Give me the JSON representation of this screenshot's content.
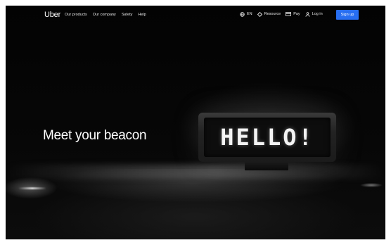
{
  "nav": {
    "logo": "Uber",
    "links": [
      "Our products",
      "Our company",
      "Safety",
      "Help"
    ],
    "language": "EN",
    "resource_label": "Resource",
    "pay_label": "Pay",
    "login_label": "Log in",
    "signup_label": "Sign up",
    "icons": [
      "globe-icon",
      "diamond-icon",
      "card-icon",
      "person-icon"
    ]
  },
  "hero": {
    "headline": "Meet your beacon",
    "beacon_display": "HELLO!"
  },
  "colors": {
    "background": "#050505",
    "signup_button": "#276ef1",
    "text": "#ffffff"
  }
}
